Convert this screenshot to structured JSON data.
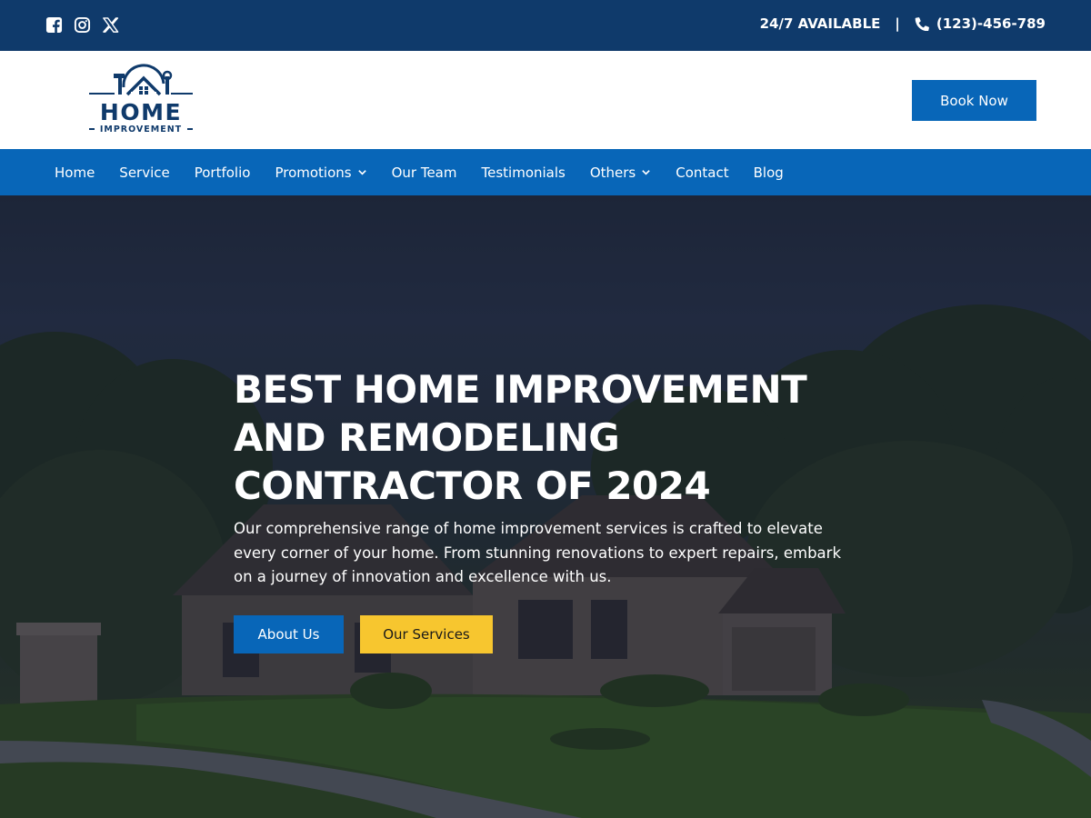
{
  "topbar": {
    "social_icons": [
      "facebook-icon",
      "instagram-icon",
      "x-icon"
    ],
    "availability": "24/7 AVAILABLE",
    "separator": "|",
    "phone_icon": "phone-icon",
    "phone": "(123)-456-789"
  },
  "header": {
    "logo_word": "HOME",
    "logo_sub": "IMPROVEMENT",
    "book_label": "Book Now"
  },
  "nav": {
    "items": [
      {
        "label": "Home"
      },
      {
        "label": "Service"
      },
      {
        "label": "Portfolio"
      },
      {
        "label": "Promotions",
        "dropdown": true
      },
      {
        "label": "Our Team"
      },
      {
        "label": "Testimonials"
      },
      {
        "label": "Others",
        "dropdown": true
      },
      {
        "label": "Contact"
      },
      {
        "label": "Blog"
      }
    ]
  },
  "hero": {
    "title_lines": [
      "BEST HOME IMPROVEMENT",
      "AND REMODELING",
      "CONTRACTOR OF 2024"
    ],
    "description": "Our comprehensive range of home improvement services is crafted to elevate every corner of your home. From stunning renovations to expert repairs, embark on a journey of innovation and excellence with us.",
    "about_label": "About Us",
    "services_label": "Our Services"
  },
  "colors": {
    "topbar": "#0f3a6b",
    "primary": "#0866b8",
    "accent": "#f7c62f"
  }
}
